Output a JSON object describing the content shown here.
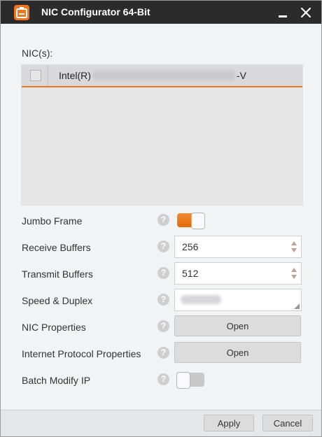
{
  "window": {
    "title": "NIC Configurator 64-Bit",
    "accent_color": "#ee7621",
    "titlebar_color": "#2b2b2b",
    "app_icon": "nic-configurator-app-icon",
    "minimize_icon": "minimize-icon",
    "close_icon": "close-icon"
  },
  "nic_section": {
    "label": "NIC(s):",
    "items": [
      {
        "checked": false,
        "name_prefix": "Intel(R)",
        "name_suffix": "-V",
        "name_obscured": true
      }
    ]
  },
  "settings": {
    "jumbo_frame": {
      "label": "Jumbo Frame",
      "enabled": true
    },
    "receive_buffers": {
      "label": "Receive Buffers",
      "value": "256"
    },
    "transmit_buffers": {
      "label": "Transmit Buffers",
      "value": "512"
    },
    "speed_duplex": {
      "label": "Speed & Duplex",
      "value_obscured": true
    },
    "nic_properties": {
      "label": "NIC Properties",
      "button_label": "Open"
    },
    "internet_protocol_properties": {
      "label": "Internet Protocol Properties",
      "button_label": "Open"
    },
    "batch_modify_ip": {
      "label": "Batch Modify IP",
      "enabled": false
    },
    "help_glyph": "?",
    "help_icon": "question-mark-icon",
    "toggle_on_color": "#ef7a1d"
  },
  "footer": {
    "apply_label": "Apply",
    "cancel_label": "Cancel"
  }
}
